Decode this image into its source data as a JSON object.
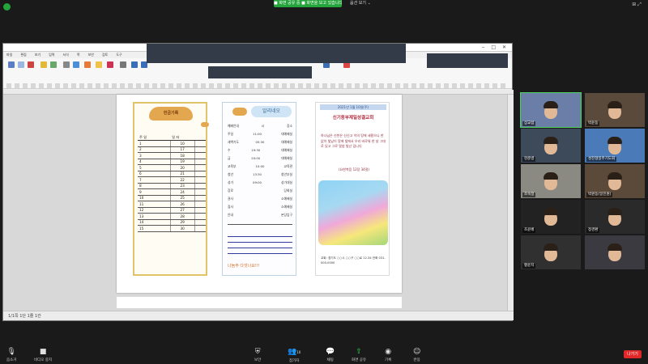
{
  "banner": {
    "share_text": "■ 화면 공유 중 ■ 화면을 보고 있습니다.",
    "view_option": "옵션 보기 ⌄"
  },
  "doc": {
    "menu": [
      "파일",
      "편집",
      "보기",
      "입력",
      "서식",
      "쪽",
      "보안",
      "검토",
      "도구"
    ],
    "status": "1/1쪽  1단  1줄  1칸"
  },
  "panel1": {
    "header": "헌금기록",
    "columns": [
      "주 일",
      "일 자",
      ""
    ],
    "rows": [
      [
        "1",
        "10",
        ""
      ],
      [
        "2",
        "17",
        ""
      ],
      [
        "3",
        "18",
        ""
      ],
      [
        "4",
        "19",
        ""
      ],
      [
        "5",
        "20",
        ""
      ],
      [
        "6",
        "21",
        ""
      ],
      [
        "7",
        "22",
        ""
      ],
      [
        "8",
        "23",
        ""
      ],
      [
        "9",
        "24",
        ""
      ],
      [
        "10",
        "25",
        ""
      ],
      [
        "11",
        "26",
        ""
      ],
      [
        "12",
        "27",
        ""
      ],
      [
        "13",
        "28",
        ""
      ],
      [
        "14",
        "29",
        ""
      ],
      [
        "15",
        "30",
        ""
      ]
    ]
  },
  "panel2": {
    "title": "알리네오",
    "rows": [
      [
        "예배안내",
        "시",
        "장소"
      ],
      [
        "주일",
        "11:00",
        "대예배실"
      ],
      [
        "새벽기도",
        "05:30",
        "대예배실"
      ],
      [
        "수",
        "19:30",
        "대예배실"
      ],
      [
        "금",
        "20:00",
        "대예배실"
      ],
      [
        "교육부",
        "10:00",
        "교육관"
      ],
      [
        "청년",
        "13:30",
        "청년부실"
      ],
      [
        "성가",
        "09:00",
        "성가대실"
      ],
      [
        "장로",
        "",
        "당회실"
      ],
      [
        "권사",
        "",
        "소예배실"
      ],
      [
        "집사",
        "",
        "소예배실"
      ],
      [
        "안내",
        "",
        "본당입구"
      ]
    ],
    "footer": "나눔주 다섯나요!!!"
  },
  "panel3": {
    "date": "2021년 1월 10일(주)",
    "title": "신기동부제일성결교회",
    "verse": "하나님은 신천은 신신고 이의 땅에 세웠으니 한 없이 빛남이 땅에 빛에서 우리 바로워 한 날 그대로 있고 그로 말씀 빛난 입니다",
    "reference": "(요한복음 12장 34절)",
    "note": "교회: 경기도 ○○시 ○○구 ○○로 12-34  전화 031-000-0000"
  },
  "participants": [
    {
      "name": "상교섭",
      "active": true
    },
    {
      "name": "박윤동"
    },
    {
      "name": "현준병"
    },
    {
      "name": "성진형일주기도회"
    },
    {
      "name": "조숙정"
    },
    {
      "name": "박원동(일진원)"
    },
    {
      "name": "조윤배"
    },
    {
      "name": "정경환"
    },
    {
      "name": "황윤지"
    },
    {
      "name": ""
    }
  ],
  "toolbar": {
    "mute": "음소거",
    "video": "비디오 중지",
    "security": "보안",
    "participants": "참가자",
    "participants_count": "10",
    "chat": "채팅",
    "share": "화면 공유",
    "record": "기록",
    "reactions": "반응",
    "leave": "나가기"
  },
  "colors": {
    "share_green": "#23a53b",
    "leave_red": "#e02828",
    "active_outline": "#4cd35a"
  }
}
